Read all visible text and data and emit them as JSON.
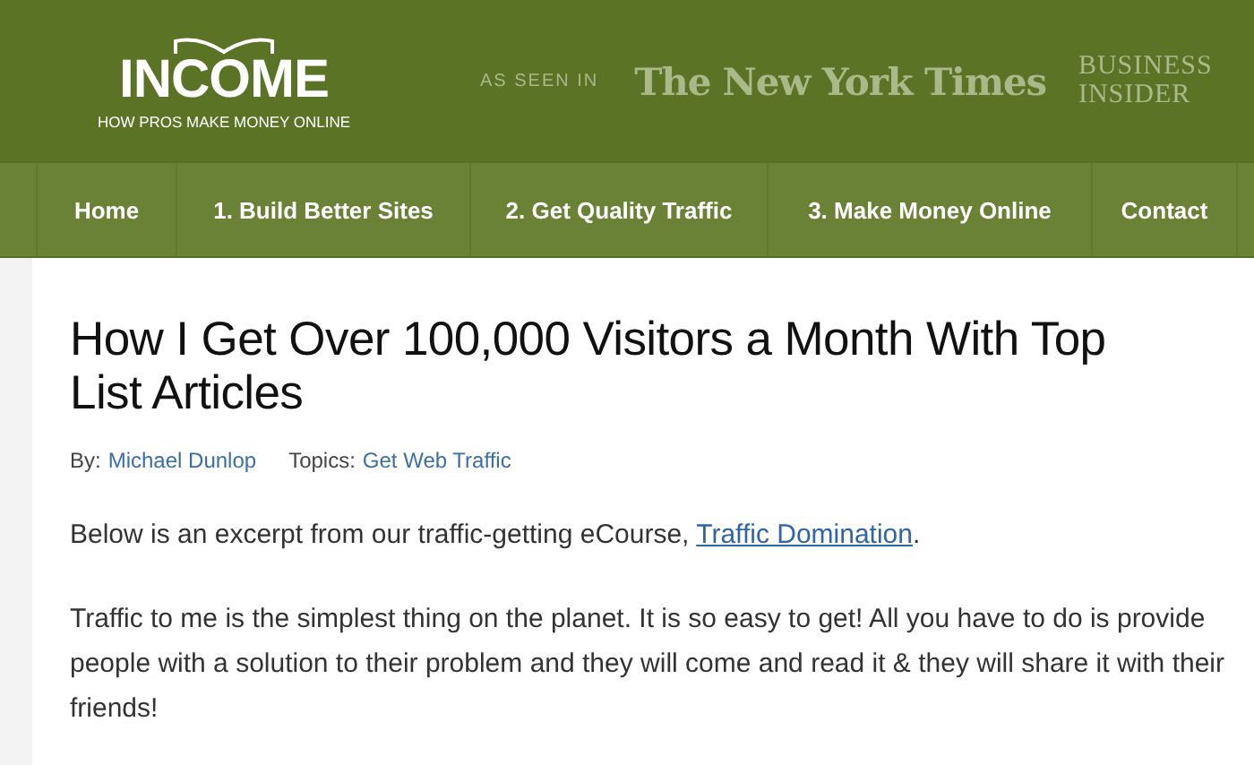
{
  "header": {
    "logo": "INCOME",
    "tagline": "HOW PROS MAKE MONEY ONLINE",
    "as_seen_in": "AS SEEN IN",
    "press": [
      {
        "kind": "blackletter",
        "name": "The New York Times"
      },
      {
        "kind": "stacked",
        "name": "BUSINESS INSIDER"
      }
    ]
  },
  "nav": [
    {
      "label": "Home"
    },
    {
      "label": "1. Build Better Sites"
    },
    {
      "label": "2. Get Quality Traffic"
    },
    {
      "label": "3. Make Money Online"
    },
    {
      "label": "Contact"
    }
  ],
  "article": {
    "title": "How I Get Over 100,000 Visitors a Month With Top List Articles",
    "byline": {
      "by_label": "By:",
      "author": "Michael Dunlop",
      "topics_label": "Topics:",
      "topic": "Get Web Traffic"
    },
    "intro": {
      "before": "Below is an excerpt from our traffic-getting eCourse, ",
      "link": "Traffic Domination",
      "after": "."
    },
    "paragraphs": [
      "Traffic to me is the simplest thing on the planet. It is so easy to get! All you have to do is provide people with a solution to their problem and they will come and read it & they will share it with their friends!"
    ]
  }
}
